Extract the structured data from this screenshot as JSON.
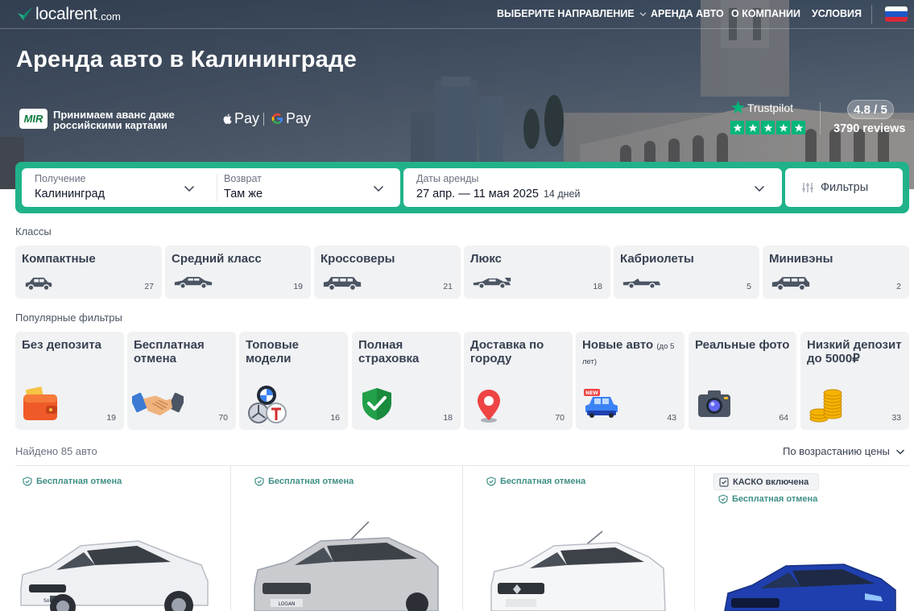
{
  "header": {
    "logo_main": "localrent",
    "logo_suffix": ".com",
    "nav": [
      {
        "label": "ВЫБЕРИТЕ НАПРАВЛЕНИЕ",
        "has_dropdown": true
      },
      {
        "label": "АРЕНДА АВТО"
      },
      {
        "label": "О КОМПАНИИ"
      },
      {
        "label": "УСЛОВИЯ"
      }
    ],
    "language_flag": "russian-flag-icon"
  },
  "hero": {
    "title": "Аренда авто в Калининграде",
    "mir_logo": "MIR",
    "mir_text": "Принимаем аванс даже российскими картами",
    "apple_pay": "Pay",
    "google_pay": "Pay",
    "trustpilot": {
      "label": "Trustpilot",
      "stars": 5,
      "rating": "4.8 / 5",
      "reviews": "3790 reviews"
    }
  },
  "search": {
    "pickup_label": "Получение",
    "pickup_value": "Калининград",
    "return_label": "Возврат",
    "return_value": "Там же",
    "dates_label": "Даты аренды",
    "dates_value": "27 апр. — 11 мая 2025",
    "dates_days": "14 дней",
    "filters_label": "Фильтры"
  },
  "classes": {
    "label": "Классы",
    "items": [
      {
        "title": "Компактные",
        "count": "27",
        "icon": "compact-car-icon"
      },
      {
        "title": "Средний класс",
        "count": "19",
        "icon": "sedan-car-icon"
      },
      {
        "title": "Кроссоверы",
        "count": "21",
        "icon": "suv-car-icon"
      },
      {
        "title": "Люкс",
        "count": "18",
        "icon": "luxury-car-icon"
      },
      {
        "title": "Кабриолеты",
        "count": "5",
        "icon": "convertible-car-icon"
      },
      {
        "title": "Минивэны",
        "count": "2",
        "icon": "minivan-icon"
      }
    ]
  },
  "popular": {
    "label": "Популярные фильтры",
    "items": [
      {
        "title": "Без депозита",
        "note": "",
        "count": "19",
        "icon": "wallet-icon"
      },
      {
        "title": "Бесплатная отмена",
        "note": "",
        "count": "70",
        "icon": "handshake-icon"
      },
      {
        "title": "Топовые модели",
        "note": "",
        "count": "16",
        "icon": "brand-logos-icon"
      },
      {
        "title": "Полная страховка",
        "note": "",
        "count": "18",
        "icon": "shield-check-icon"
      },
      {
        "title": "Доставка по городу",
        "note": "",
        "count": "70",
        "icon": "map-pin-icon"
      },
      {
        "title": "Новые авто",
        "note": "(до 5 лет)",
        "count": "43",
        "icon": "new-car-icon"
      },
      {
        "title": "Реальные фото",
        "note": "",
        "count": "64",
        "icon": "camera-icon"
      },
      {
        "title": "Низкий депозит до 5000₽",
        "note": "",
        "count": "33",
        "icon": "coins-icon"
      }
    ]
  },
  "results": {
    "found": "Найдено 85 авто",
    "sort": "По возрастанию цены",
    "cars": [
      {
        "badge": "Бесплатная отмена",
        "kasko": "",
        "color": "#f2f3f5"
      },
      {
        "badge": "Бесплатная отмена",
        "kasko": "",
        "color": "#c9cbcf"
      },
      {
        "badge": "Бесплатная отмена",
        "kasko": "",
        "color": "#f5f6f8"
      },
      {
        "badge": "Бесплатная отмена",
        "kasko": "КАСКО включена",
        "color": "#1f3fae"
      }
    ]
  },
  "colors": {
    "accent": "#21b28a",
    "trustpilot": "#00b67a",
    "badge_text": "#3f8f85"
  }
}
